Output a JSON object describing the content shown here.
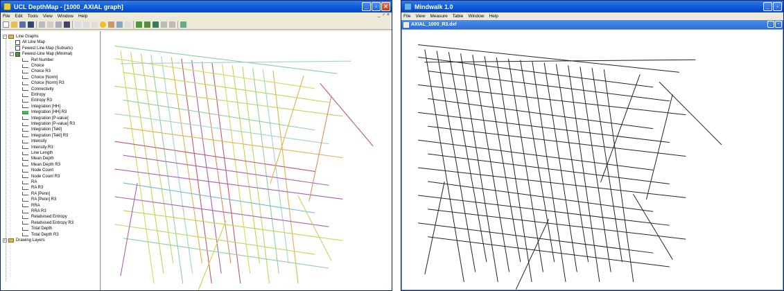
{
  "left_window": {
    "title": "UCL DepthMap - [1000_AXIAL graph]",
    "menu": [
      "File",
      "Edit",
      "Tools",
      "View",
      "Window",
      "Help"
    ],
    "mdi_controls": "_ ♂ ×",
    "tree": {
      "root": "Line Graphs",
      "maps": [
        {
          "label": "All Line Map",
          "checked": false
        },
        {
          "label": "Fewest Line Map (Subsets)",
          "checked": false
        },
        {
          "label": "Fewest-Line Map (Minimal)",
          "checked": true
        }
      ],
      "attributes": [
        "Ref Number",
        "Choice",
        "Choice R3",
        "Choice [Norm]",
        "Choice [Norm] R3",
        "Connectivity",
        "Entropy",
        "Entropy R3",
        "Integration [HH]",
        "Integration [HH] R3",
        "Integration [P-value]",
        "Integration [P-value] R3",
        "Integration [Tekl]",
        "Integration [Tekl] R3",
        "Intensity",
        "Intensity R3",
        "Line Length",
        "Mean Depth",
        "Mean Depth R3",
        "Node Count",
        "Node Count R3",
        "RA",
        "RA R3",
        "RA [Penn]",
        "RA [Penn] R3",
        "RRA",
        "RRA R3",
        "Relativised Entropy",
        "Relativised Entropy R3",
        "Total Depth",
        "Total Depth R3"
      ],
      "selected_attribute": "Integration [HH] R3",
      "layers": "Drawing Layers"
    }
  },
  "right_window": {
    "title": "Mindwalk 1.0",
    "menu": [
      "File",
      "View",
      "Measure",
      "Table",
      "Window",
      "Help"
    ],
    "child_title": "AXIAL_1000_R3.dxf"
  },
  "colors": {
    "line_colors": [
      "#d6d65a",
      "#c8cf4a",
      "#b9d95e",
      "#8fcf9a",
      "#9fd0d8",
      "#e0b24a",
      "#c4546a",
      "#a85fb0",
      "#e08a5a",
      "#6fb8d8"
    ]
  },
  "icons": {
    "window_icon": "app-icon",
    "minimize": "minimize-icon",
    "maximize": "maximize-icon",
    "close": "close-icon"
  }
}
